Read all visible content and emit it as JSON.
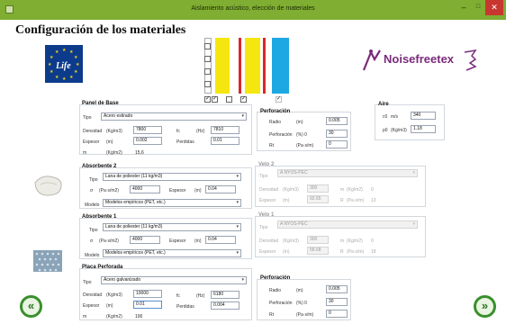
{
  "window": {
    "title": "Aislamiento acústico, elección de materiales",
    "minimize_glyph": "–",
    "maximize_glyph": "□",
    "close_glyph": "✕"
  },
  "page": {
    "heading": "Configuración de los  materiales"
  },
  "logos": {
    "life": "Life",
    "noisefreetex": "Noisefreetex"
  },
  "layer_checkboxes": [
    "✓",
    "✓",
    "",
    "✓",
    "✓"
  ],
  "colors": {
    "titlebar": "#7fae32",
    "yellow": "#f5e60f",
    "red": "#d9262b",
    "blue": "#1ea8e2",
    "nav_green": "#3a8f2c"
  },
  "panel_base": {
    "title": "Panel de Base",
    "tipo_label": "Tipo",
    "tipo_value": "Acero estirado",
    "densidad_label": "Densidad",
    "densidad_unit": "(Kg/m3)",
    "densidad_value": "7800",
    "espesor_label": "Espesor",
    "espesor_unit": "(m)",
    "espesor_value": "0.002",
    "m_label": "m",
    "m_unit": "(Kg/m2)",
    "m_value": "15,6",
    "fc_label": "fc",
    "fc_unit": "(Hz)",
    "fc_value": "7810",
    "perdidas_label": "Perdidas",
    "perdidas_value": "0.01"
  },
  "perforacion_top": {
    "title": "Perforación",
    "radio_label": "Radio",
    "radio_unit": "(m)",
    "radio_value": "0.005",
    "perf_label": "Perforación",
    "perf_unit": "(%) 0",
    "perf_value": "30",
    "rt_label": "Rt",
    "rt_unit": "(Pa·s/m)",
    "rt_value": "0"
  },
  "aire": {
    "title": "Aire",
    "c0_label": "c0",
    "c0_unit": "m/s",
    "c0_value": "340",
    "rho_label": "p0",
    "rho_unit": "(Kg/m3)",
    "rho_value": "1.18"
  },
  "absorbente2": {
    "title": "Absorbente 2",
    "tipo_label": "Tipo",
    "tipo_value": "Lana de poliester (11 kg/m3)",
    "sigma_label": "σ",
    "sigma_unit": "(Pa·s/m2)",
    "sigma_value": "4000",
    "espesor_label": "Espesor",
    "espesor_unit": "(m)",
    "espesor_value": "0.04",
    "modelo_label": "Modelo",
    "modelo_value": "Modelos empíricos (PET, etc.)"
  },
  "velo2": {
    "title": "Velo 2",
    "tipo_label": "Tipo",
    "tipo_value": "A NYOS-PEC",
    "densidad_label": "Densidad",
    "densidad_unit": "(Kg/m3)",
    "densidad_value": "300",
    "espesor_label": "Espesor",
    "espesor_unit": "(m)",
    "espesor_value": "92.65",
    "m_label": "m",
    "m_unit": "(Kg/m2)",
    "m_value": "0",
    "r_label": "R",
    "r_unit": "(Pa·s/m)",
    "r_value": "13"
  },
  "absorbente1": {
    "title": "Absorbente 1",
    "tipo_label": "Tipo",
    "tipo_value": "Lana de poliester (11 kg/m3)",
    "sigma_label": "σ",
    "sigma_unit": "(Pa·s/m2)",
    "sigma_value": "4000",
    "espesor_label": "Espesor",
    "espesor_unit": "(m)",
    "espesor_value": "0.04",
    "modelo_label": "Modelo",
    "modelo_value": "Modelos empíricos (PET, etc.)"
  },
  "velo1": {
    "title": "Velo 1",
    "tipo_label": "Tipo",
    "tipo_value": "A NYOS-PEC",
    "densidad_label": "Densidad",
    "densidad_unit": "(Kg/m3)",
    "densidad_value": "300",
    "espesor_label": "Espesor",
    "espesor_unit": "(m)",
    "espesor_value": "58.68",
    "m_label": "m",
    "m_unit": "(Kg/m2)",
    "m_value": "0",
    "r_label": "R",
    "r_unit": "(Pa·s/m)",
    "r_value": "18"
  },
  "placa_perforada": {
    "title": "Placa Perforada",
    "tipo_label": "Tipo",
    "tipo_value": "Acero galvanizado",
    "densidad_label": "Densidad",
    "densidad_unit": "(Kg/m3)",
    "densidad_value": "10000",
    "espesor_label": "Espesor",
    "espesor_unit": "(m)",
    "espesor_value": "0.01",
    "m_label": "m",
    "m_unit": "(Kg/m2)",
    "m_value": "100",
    "fc_label": "fc",
    "fc_unit": "(Hz)",
    "fc_value": "6180",
    "perdidas_label": "Perdidas",
    "perdidas_value": "0.004"
  },
  "perforacion_bottom": {
    "title": "Perforación",
    "radio_label": "Radio",
    "radio_unit": "(m)",
    "radio_value": "0.005",
    "perf_label": "Perforación",
    "perf_unit": "(%) 0",
    "perf_value": "30",
    "rt_label": "Rt",
    "rt_unit": "(Pa·s/m)",
    "rt_value": "0"
  },
  "nav": {
    "back": "«",
    "next": "»"
  }
}
